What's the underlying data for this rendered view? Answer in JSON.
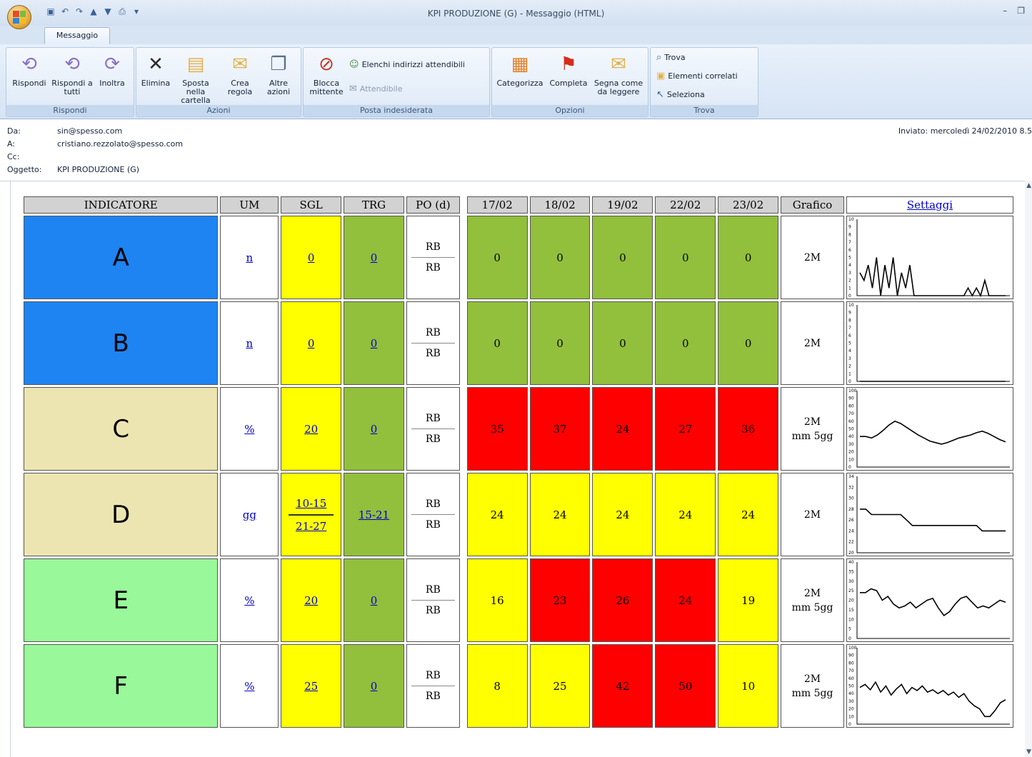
{
  "window": {
    "title": "KPI PRODUZIONE (G) - Messaggio (HTML)",
    "tab": "Messaggio"
  },
  "ribbon": {
    "groups": [
      {
        "label": "Rispondi"
      },
      {
        "label": "Azioni"
      },
      {
        "label": "Posta indesiderata"
      },
      {
        "label": "Opzioni"
      },
      {
        "label": "Trova"
      }
    ],
    "buttons": {
      "rispondi": "Rispondi",
      "rispondi_tutti": "Rispondi a tutti",
      "inoltra": "Inoltra",
      "elimina": "Elimina",
      "sposta": "Sposta nella cartella",
      "crea_regola": "Crea regola",
      "altre_azioni": "Altre azioni",
      "blocca": "Blocca mittente",
      "elenchi": "Elenchi indirizzi attendibili",
      "attendibile": "Attendibile",
      "categorizza": "Categorizza",
      "completa": "Completa",
      "segna": "Segna come da leggere",
      "trova": "Trova",
      "elementi": "Elementi correlati",
      "seleziona": "Seleziona"
    }
  },
  "header": {
    "da_label": "Da:",
    "da_value": "sin@spesso.com",
    "a_label": "A:",
    "a_value": "cristiano.rezzolato@spesso.com",
    "cc_label": "Cc:",
    "cc_value": "",
    "oggetto_label": "Oggetto:",
    "oggetto_value": "KPI PRODUZIONE (G)",
    "inviato_label": "Inviato:",
    "inviato_value": "mercoledì 24/02/2010 8.5"
  },
  "table": {
    "headers": [
      "INDICATORE",
      "UM",
      "SGL",
      "TRG",
      "PO (d)",
      "17/02",
      "18/02",
      "19/02",
      "22/02",
      "23/02",
      "Grafico",
      "Settaggi"
    ],
    "rows": [
      {
        "name": "A",
        "color": "#1e84f2",
        "um": "n",
        "sgl": "0",
        "trg": "0",
        "po_top": "RB",
        "po_bot": "RB",
        "days": [
          {
            "v": "0",
            "c": "#92bf3c"
          },
          {
            "v": "0",
            "c": "#92bf3c"
          },
          {
            "v": "0",
            "c": "#92bf3c"
          },
          {
            "v": "0",
            "c": "#92bf3c"
          },
          {
            "v": "0",
            "c": "#92bf3c"
          }
        ],
        "grafico": "2M",
        "grafico2": ""
      },
      {
        "name": "B",
        "color": "#1e84f2",
        "um": "n",
        "sgl": "0",
        "trg": "0",
        "po_top": "RB",
        "po_bot": "RB",
        "days": [
          {
            "v": "0",
            "c": "#92bf3c"
          },
          {
            "v": "0",
            "c": "#92bf3c"
          },
          {
            "v": "0",
            "c": "#92bf3c"
          },
          {
            "v": "0",
            "c": "#92bf3c"
          },
          {
            "v": "0",
            "c": "#92bf3c"
          }
        ],
        "grafico": "2M",
        "grafico2": ""
      },
      {
        "name": "C",
        "color": "#ede5b1",
        "um": "%",
        "sgl": "20",
        "trg": "0",
        "po_top": "RB",
        "po_bot": "RB",
        "days": [
          {
            "v": "35",
            "c": "#ff0000"
          },
          {
            "v": "37",
            "c": "#ff0000"
          },
          {
            "v": "24",
            "c": "#ff0000"
          },
          {
            "v": "27",
            "c": "#ff0000"
          },
          {
            "v": "36",
            "c": "#ff0000"
          }
        ],
        "grafico": "2M",
        "grafico2": "mm 5gg"
      },
      {
        "name": "D",
        "color": "#ede5b1",
        "um": "gg",
        "sgl": "10-15",
        "sgl2": "21-27",
        "trg": "15-21",
        "po_top": "RB",
        "po_bot": "RB",
        "days": [
          {
            "v": "24",
            "c": "#ffff00"
          },
          {
            "v": "24",
            "c": "#ffff00"
          },
          {
            "v": "24",
            "c": "#ffff00"
          },
          {
            "v": "24",
            "c": "#ffff00"
          },
          {
            "v": "24",
            "c": "#ffff00"
          }
        ],
        "grafico": "2M",
        "grafico2": ""
      },
      {
        "name": "E",
        "color": "#99f899",
        "um": "%",
        "sgl": "20",
        "trg": "0",
        "po_top": "RB",
        "po_bot": "RB",
        "days": [
          {
            "v": "16",
            "c": "#ffff00"
          },
          {
            "v": "23",
            "c": "#ff0000"
          },
          {
            "v": "26",
            "c": "#ff0000"
          },
          {
            "v": "24",
            "c": "#ff0000"
          },
          {
            "v": "19",
            "c": "#ffff00"
          }
        ],
        "grafico": "2M",
        "grafico2": "mm 5gg"
      },
      {
        "name": "F",
        "color": "#99f899",
        "um": "%",
        "sgl": "25",
        "trg": "0",
        "po_top": "RB",
        "po_bot": "RB",
        "days": [
          {
            "v": "8",
            "c": "#ffff00"
          },
          {
            "v": "25",
            "c": "#ffff00"
          },
          {
            "v": "42",
            "c": "#ff0000"
          },
          {
            "v": "50",
            "c": "#ff0000"
          },
          {
            "v": "10",
            "c": "#ffff00"
          }
        ],
        "grafico": "2M",
        "grafico2": "mm 5gg"
      }
    ],
    "sparklines": [
      {
        "ylim": [
          0,
          10
        ],
        "ticks": [
          "10",
          "9",
          "8",
          "7",
          "6",
          "5",
          "4",
          "3",
          "2",
          "1",
          "0"
        ],
        "values": [
          3,
          2,
          4,
          1,
          5,
          0,
          4,
          1,
          5,
          0,
          3,
          1,
          4,
          0,
          0,
          0,
          0,
          0,
          0,
          0,
          0,
          0,
          0,
          0,
          0,
          0,
          1,
          0,
          1,
          0,
          2,
          0,
          0,
          0,
          0,
          0
        ]
      },
      {
        "ylim": [
          0,
          10
        ],
        "ticks": [
          "10",
          "9",
          "8",
          "7",
          "6",
          "5",
          "4",
          "3",
          "2",
          "1",
          "0"
        ],
        "values": [
          0,
          0,
          0,
          0,
          0,
          0,
          0,
          0,
          0,
          0,
          0,
          0,
          0,
          0,
          0,
          0,
          0,
          0,
          0,
          0,
          0,
          0,
          0,
          0,
          0,
          0,
          0,
          0,
          0,
          0,
          0,
          0,
          0,
          0,
          0,
          0
        ]
      },
      {
        "ylim": [
          0,
          100
        ],
        "ticks": [
          "100",
          "90",
          "80",
          "70",
          "60",
          "50",
          "40",
          "30",
          "20",
          "10",
          "0"
        ],
        "values": [
          40,
          40,
          38,
          42,
          48,
          55,
          60,
          57,
          52,
          47,
          42,
          38,
          34,
          32,
          30,
          32,
          35,
          38,
          40,
          42,
          45,
          47,
          44,
          40,
          36,
          33
        ]
      },
      {
        "ylim": [
          20,
          34
        ],
        "ticks": [
          "34",
          "32",
          "30",
          "28",
          "26",
          "24",
          "22",
          "20"
        ],
        "values": [
          28,
          28,
          27,
          27,
          27,
          27,
          27,
          27,
          26,
          25,
          25,
          25,
          25,
          25,
          25,
          25,
          25,
          25,
          25,
          25,
          25,
          24,
          24,
          24,
          24,
          24
        ]
      },
      {
        "ylim": [
          0,
          40
        ],
        "ticks": [
          "40",
          "35",
          "30",
          "25",
          "20",
          "15",
          "10",
          "5",
          "0"
        ],
        "values": [
          24,
          24,
          26,
          25,
          20,
          22,
          18,
          16,
          17,
          19,
          16,
          18,
          20,
          21,
          16,
          12,
          14,
          18,
          21,
          22,
          19,
          16,
          17,
          16,
          18,
          20,
          19
        ]
      },
      {
        "ylim": [
          0,
          100
        ],
        "ticks": [
          "100",
          "90",
          "80",
          "70",
          "60",
          "50",
          "40",
          "30",
          "20",
          "10",
          "0"
        ],
        "values": [
          48,
          52,
          45,
          55,
          42,
          50,
          38,
          46,
          52,
          40,
          48,
          44,
          50,
          42,
          45,
          40,
          44,
          38,
          42,
          35,
          40,
          30,
          24,
          20,
          10,
          10,
          18,
          28,
          32
        ]
      }
    ]
  }
}
